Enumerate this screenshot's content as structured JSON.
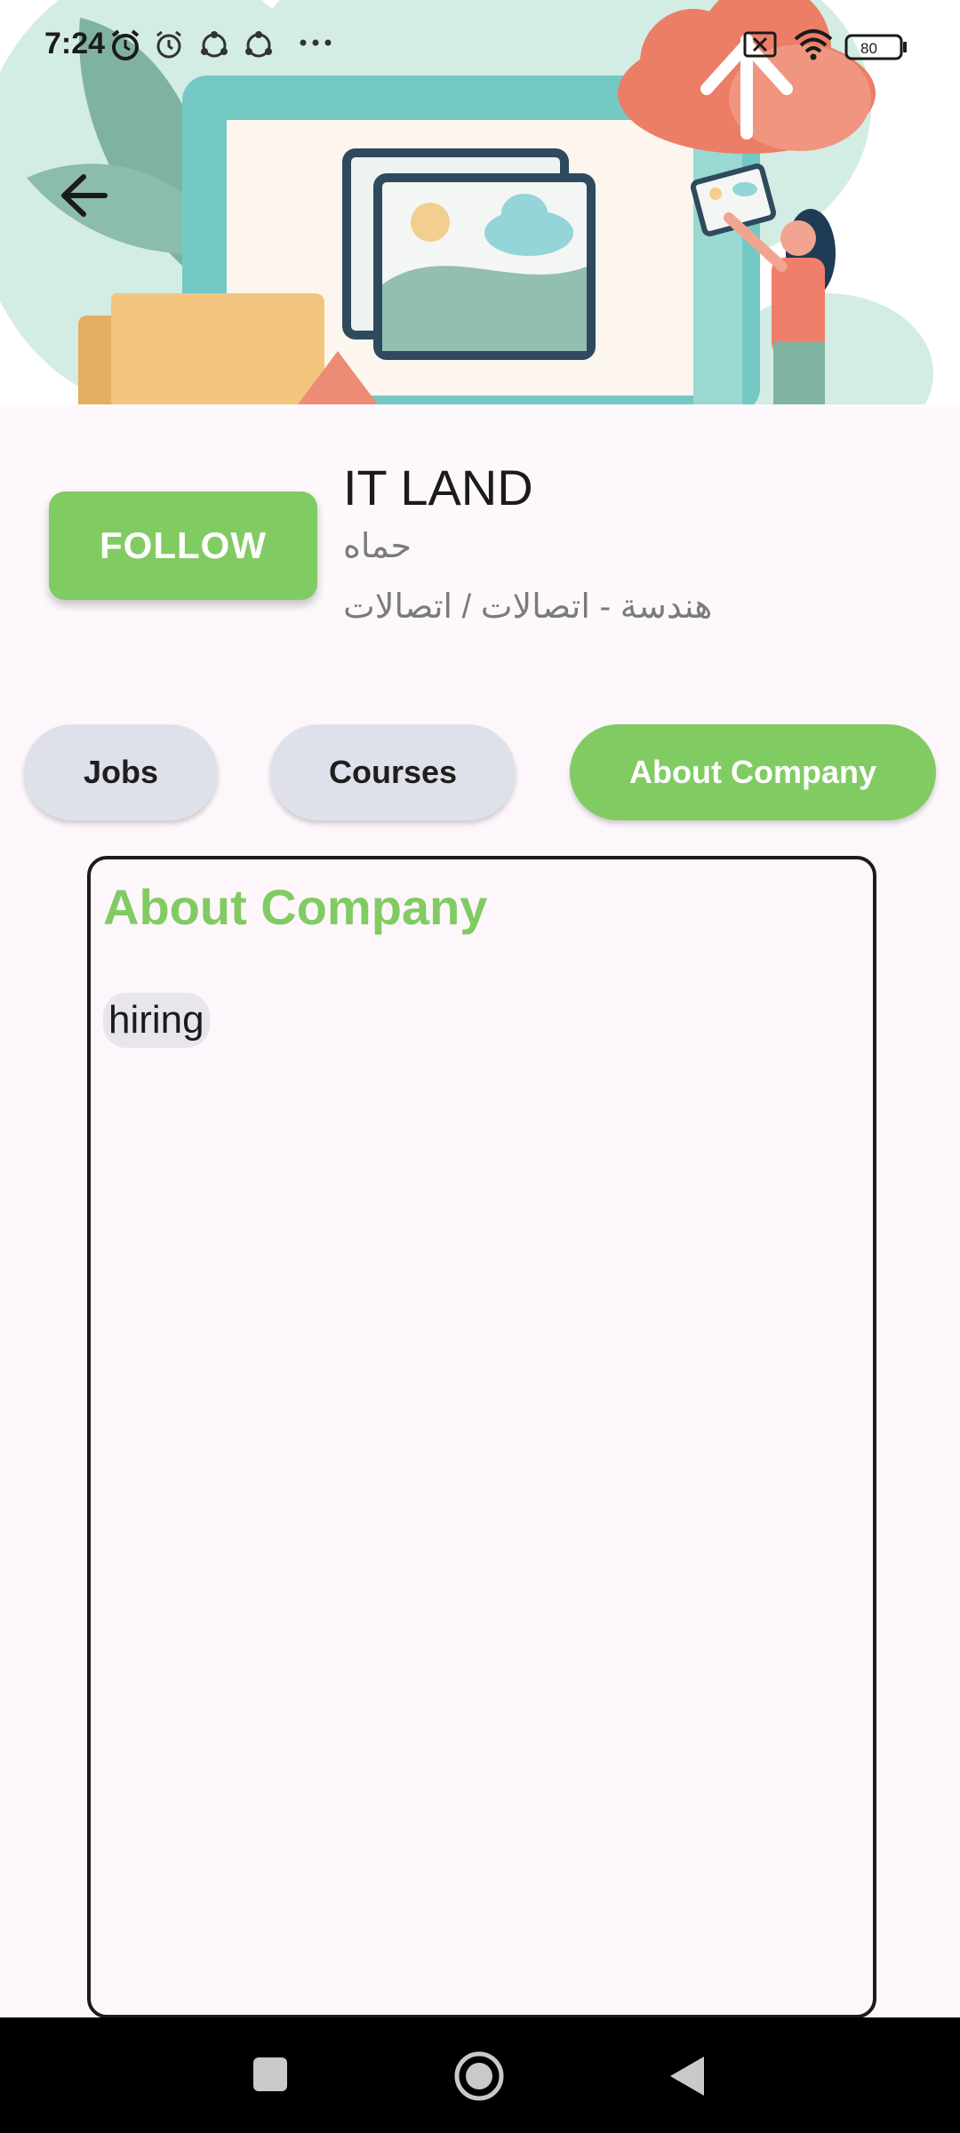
{
  "status_bar": {
    "time": "7:24",
    "icons": [
      "alarm-icon",
      "clock-icon",
      "sync-icon",
      "sync-icon",
      "more-dots-icon",
      "no-sim-icon",
      "wifi-icon",
      "battery-icon"
    ],
    "battery_level": "80"
  },
  "header": {
    "back_icon": "arrow-back-icon",
    "illustration": "cloud-upload-photo-illustration"
  },
  "company": {
    "name": "IT LAND",
    "city": "حماه",
    "category": "هندسة - اتصالات / اتصالات",
    "follow_label": "FOLLOW"
  },
  "tabs": [
    {
      "label": "Jobs",
      "active": false
    },
    {
      "label": "Courses",
      "active": false
    },
    {
      "label": "About Company",
      "active": true
    }
  ],
  "about": {
    "title": "About Company",
    "tags": [
      "hiring"
    ]
  },
  "navigation_bar": {
    "buttons": [
      "recent-apps-icon",
      "home-icon",
      "back-triangle-icon"
    ]
  },
  "colors": {
    "accent_green": "#81cb63",
    "tab_inactive": "#dfe1ea",
    "background": "#fdf7fb"
  }
}
